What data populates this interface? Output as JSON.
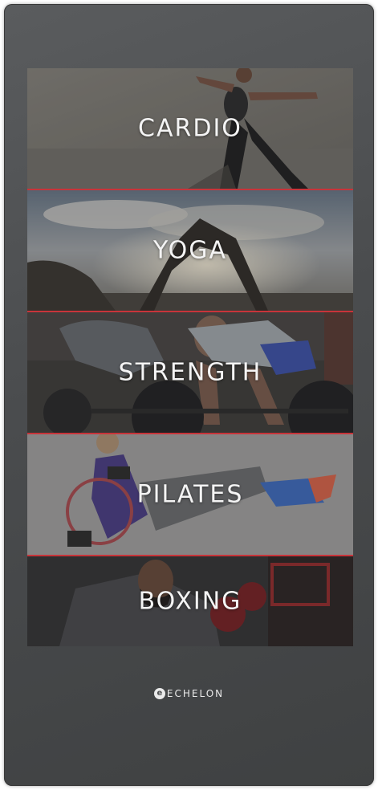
{
  "categories": [
    {
      "label": "CARDIO"
    },
    {
      "label": "YOGA"
    },
    {
      "label": "STRENGTH"
    },
    {
      "label": "PILATES"
    },
    {
      "label": "BOXING"
    }
  ],
  "brand": {
    "name": "ECHELON",
    "icon": "echelon-logo-icon"
  },
  "colors": {
    "device_background": "#4a4c4e",
    "divider": "#c8343a",
    "label_text": "#f4f4f4"
  }
}
